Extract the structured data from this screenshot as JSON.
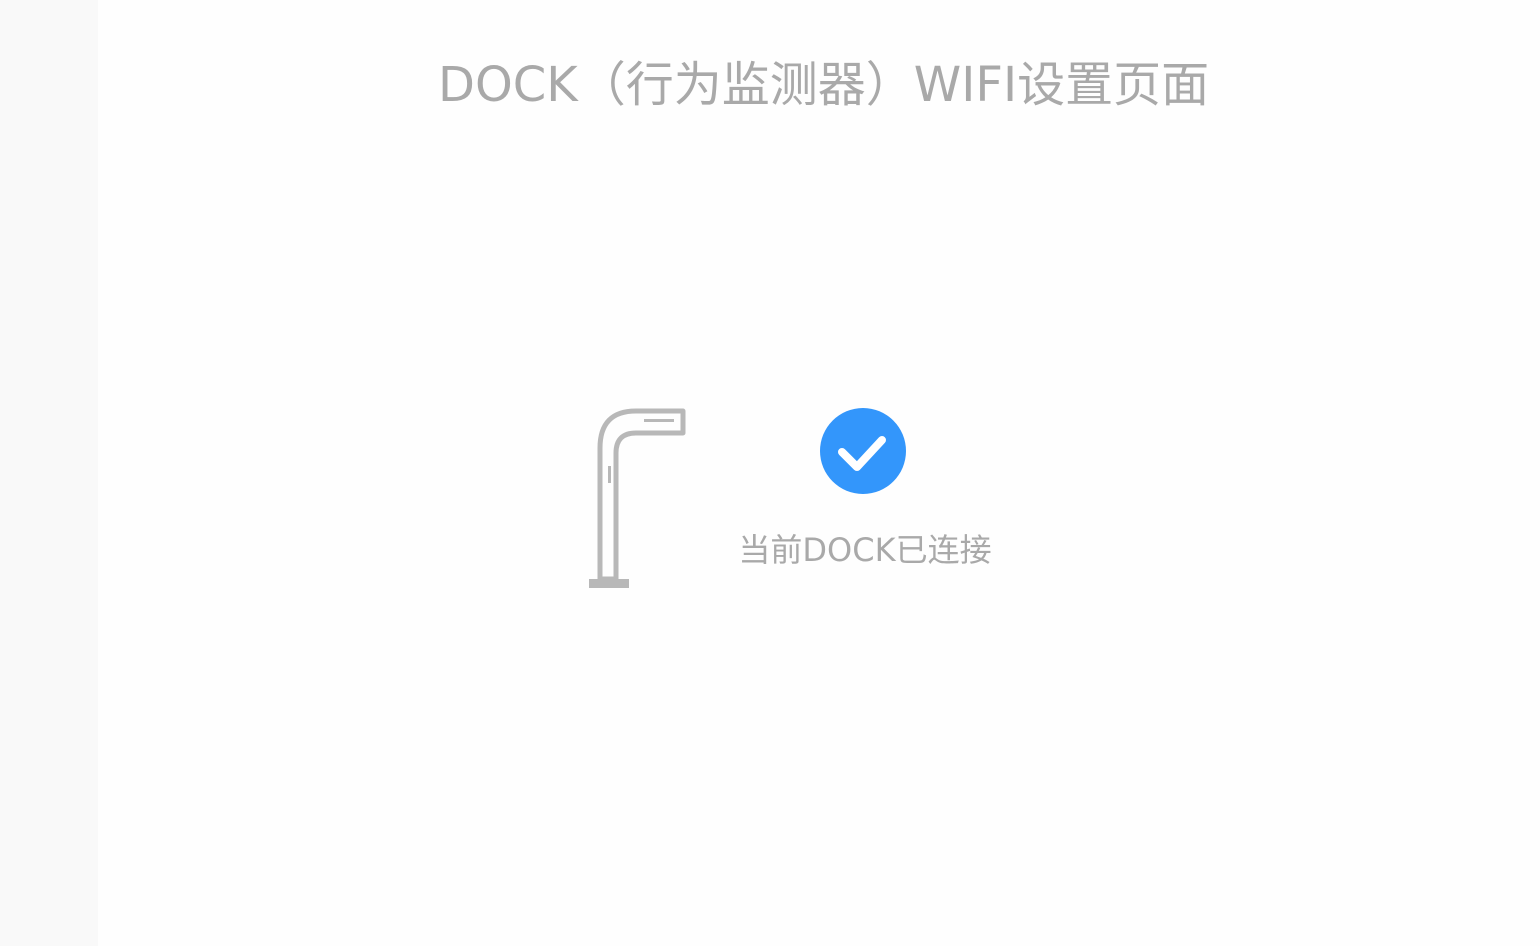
{
  "header": {
    "title": "DOCK（行为监测器）WIFI设置页面"
  },
  "status": {
    "icon": "check-circle-icon",
    "message": "当前DOCK已连接",
    "accent_color": "#3396fb"
  },
  "illustration": {
    "icon": "dock-device-icon",
    "color": "#b8b8b8"
  }
}
